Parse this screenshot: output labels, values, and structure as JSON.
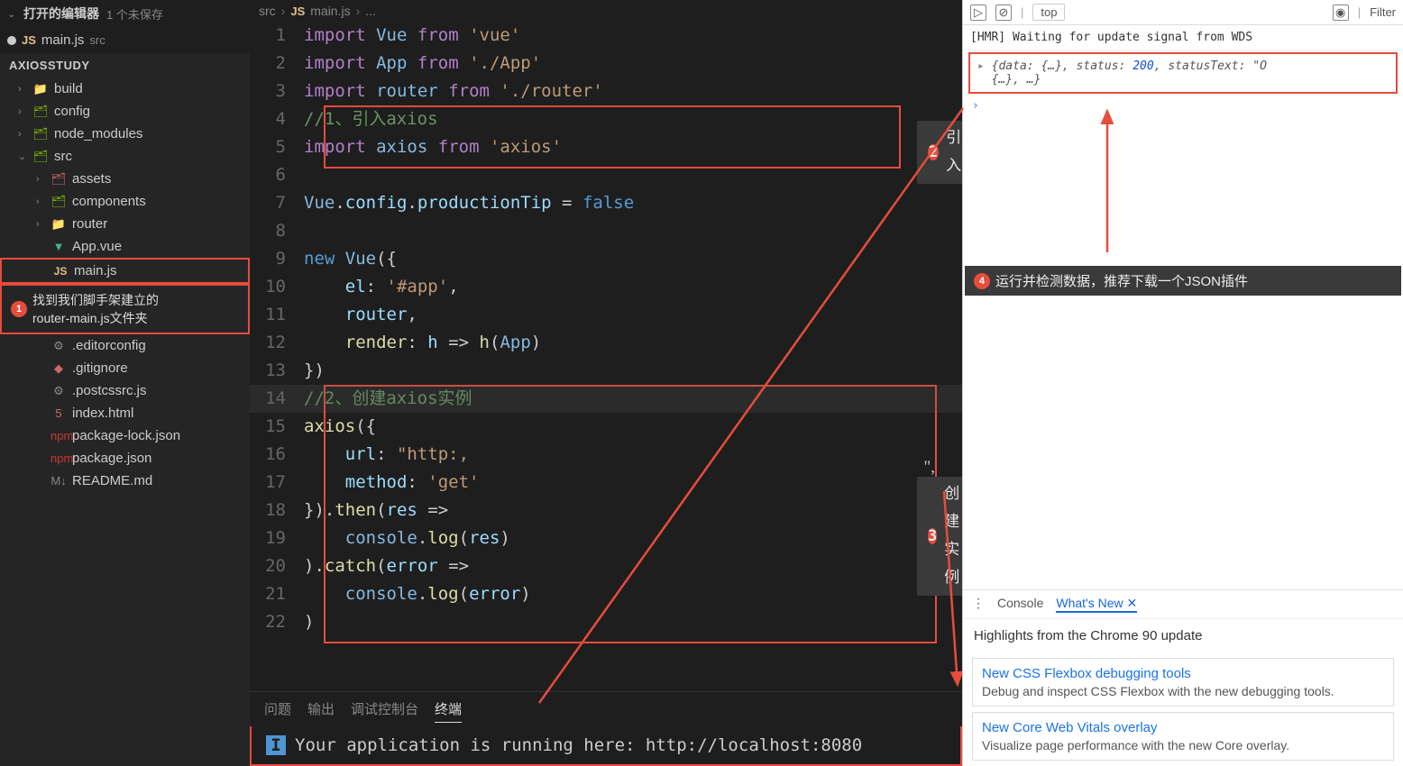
{
  "sidebar": {
    "header": "打开的编辑器",
    "unsaved": "1 个未保存",
    "tab": {
      "badge": "JS",
      "name": "main.js",
      "dir": "src"
    },
    "project": "AXIOSSTUDY",
    "items": [
      {
        "chev": "›",
        "icon": "📁",
        "cls": "fi-folder",
        "label": "build",
        "ind": "ind1"
      },
      {
        "chev": "›",
        "icon": "🗂",
        "cls": "fi-folder-g",
        "label": "config",
        "ind": "ind1"
      },
      {
        "chev": "›",
        "icon": "🗂",
        "cls": "fi-folder-g",
        "label": "node_modules",
        "ind": "ind1"
      },
      {
        "chev": "⌄",
        "icon": "🗂",
        "cls": "fi-folder-g",
        "label": "src",
        "ind": "ind1"
      },
      {
        "chev": "›",
        "icon": "🗂",
        "cls": "fi-folder-r",
        "label": "assets",
        "ind": "ind2"
      },
      {
        "chev": "›",
        "icon": "🗂",
        "cls": "fi-folder-g",
        "label": "components",
        "ind": "ind2"
      },
      {
        "chev": "›",
        "icon": "📁",
        "cls": "fi-folder",
        "label": "router",
        "ind": "ind2"
      },
      {
        "chev": "",
        "icon": "▼",
        "cls": "fi-vue",
        "label": "App.vue",
        "ind": "ind3"
      },
      {
        "chev": "",
        "icon": "JS",
        "cls": "fi-js",
        "label": "main.js",
        "ind": "ind3",
        "hl": true
      },
      {
        "chev": "",
        "icon": "⚙",
        "cls": "fi-gear",
        "label": ".editorconfig",
        "ind": "ind3"
      },
      {
        "chev": "",
        "icon": "◆",
        "cls": "fi-folder-r",
        "label": ".gitignore",
        "ind": "ind3"
      },
      {
        "chev": "",
        "icon": "⚙",
        "cls": "fi-gear",
        "label": ".postcssrc.js",
        "ind": "ind3"
      },
      {
        "chev": "",
        "icon": "5",
        "cls": "fi-folder-r",
        "label": "index.html",
        "ind": "ind3"
      },
      {
        "chev": "",
        "icon": "npm",
        "cls": "fi-npm",
        "label": "package-lock.json",
        "ind": "ind3"
      },
      {
        "chev": "",
        "icon": "npm",
        "cls": "fi-npm",
        "label": "package.json",
        "ind": "ind3"
      },
      {
        "chev": "",
        "icon": "M↓",
        "cls": "fi-gear",
        "label": "README.md",
        "ind": "ind3"
      }
    ],
    "callout": {
      "num": "1",
      "text1": "找到我们脚手架建立的",
      "text2": "router-main.js文件夹"
    }
  },
  "crumbs": {
    "p0": "src",
    "badge": "JS",
    "p1": "main.js",
    "p2": "..."
  },
  "code": {
    "lines": [
      {
        "n": "1",
        "h": "<span class='k-imp'>import</span> <span class='k-id'>Vue</span> <span class='k-imp'>from</span> <span class='k-str'>'vue'</span>"
      },
      {
        "n": "2",
        "h": "<span class='k-imp'>import</span> <span class='k-id'>App</span> <span class='k-imp'>from</span> <span class='k-str'>'./App'</span>"
      },
      {
        "n": "3",
        "h": "<span class='k-imp'>import</span> <span class='k-id'>router</span> <span class='k-imp'>from</span> <span class='k-str'>'./router'</span>"
      },
      {
        "n": "4",
        "h": "<span class='k-cmt'>//1、引入axios</span>"
      },
      {
        "n": "5",
        "h": "<span class='k-imp'>import</span> <span class='k-id'>axios</span> <span class='k-imp'>from</span> <span class='k-str'>'axios'</span>"
      },
      {
        "n": "6",
        "h": ""
      },
      {
        "n": "7",
        "h": "<span class='k-id'>Vue</span>.<span class='k-prop'>config</span>.<span class='k-prop'>productionTip</span> <span class='k-eq'>=</span> <span class='k-kw'>false</span>"
      },
      {
        "n": "8",
        "h": ""
      },
      {
        "n": "9",
        "h": "<span class='k-new'>new</span> <span class='k-id'>Vue</span>({"
      },
      {
        "n": "10",
        "h": "    <span class='k-prop'>el</span>: <span class='k-str'>'#app'</span>,"
      },
      {
        "n": "11",
        "h": "    <span class='k-prop'>router</span>,"
      },
      {
        "n": "12",
        "h": "    <span class='k-fn'>render</span>: <span class='k-prop'>h</span> <span class='k-eq'>=&gt;</span> <span class='k-fn'>h</span>(<span class='k-id'>App</span>)"
      },
      {
        "n": "13",
        "h": "})"
      },
      {
        "n": "14",
        "h": "<span class='k-cmt'>//2、创建axios实例</span>",
        "hot": true
      },
      {
        "n": "15",
        "h": "<span class='k-fn'>axios</span>({"
      },
      {
        "n": "16",
        "h": "    <span class='k-prop'>url</span>: <span class='k-str'>\"http:,</span>"
      },
      {
        "n": "17",
        "h": "    <span class='k-prop'>method</span>: <span class='k-str'>'get'</span>"
      },
      {
        "n": "18",
        "h": "}).<span class='k-fn'>then</span>(<span class='k-prop'>res</span> <span class='k-eq'>=&gt;</span>"
      },
      {
        "n": "19",
        "h": "    <span class='k-id'>console</span>.<span class='k-fn'>log</span>(<span class='k-prop'>res</span>)"
      },
      {
        "n": "20",
        "h": ").<span class='k-fn'>catch</span>(<span class='k-prop'>error</span> <span class='k-eq'>=&gt;</span>"
      },
      {
        "n": "21",
        "h": "    <span class='k-id'>console</span>.<span class='k-fn'>log</span>(<span class='k-prop'>error</span>)"
      },
      {
        "n": "22",
        "h": ")"
      }
    ]
  },
  "anno2": {
    "num": "2",
    "text": "引入"
  },
  "anno3": {
    "num": "3",
    "text": "创建实例"
  },
  "trailing": "\",",
  "term": {
    "tabs": [
      "问题",
      "输出",
      "调试控制台",
      "终端"
    ],
    "active": 3,
    "icon": "I",
    "out": "Your application is running here: http://localhost:8080"
  },
  "dev": {
    "top_sel": "top",
    "filter": "Filter",
    "hmr": "[HMR] Waiting for update signal from WDS",
    "obj1": "{data: {…}, status: ",
    "obj_num": "200",
    "obj2": ", statusText: \"O",
    "obj3": "{…}, …}",
    "prompt": "›",
    "callout": {
      "num": "4",
      "text": "运行并检测数据，推荐下载一个JSON插件"
    },
    "btabs": {
      "a": "Console",
      "b": "What's New ✕"
    },
    "hi": "Highlights from the Chrome 90 update",
    "cards": [
      {
        "t": "New CSS Flexbox debugging tools",
        "s": "Debug and inspect CSS Flexbox with the new debugging tools."
      },
      {
        "t": "New Core Web Vitals overlay",
        "s": "Visualize page performance with the new Core overlay."
      }
    ]
  }
}
